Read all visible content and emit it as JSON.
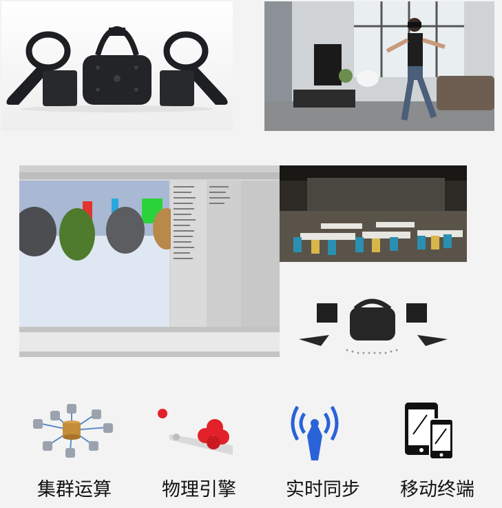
{
  "features": [
    {
      "label": "集群运算",
      "icon": "cluster-computing-icon"
    },
    {
      "label": "物理引擎",
      "icon": "physics-engine-icon"
    },
    {
      "label": "实时同步",
      "icon": "realtime-sync-icon"
    },
    {
      "label": "移动终端",
      "icon": "mobile-terminal-icon"
    }
  ],
  "colors": {
    "background": "#f3f3f3",
    "sync_blue": "#2a62d8",
    "physics_red": "#e2212a"
  }
}
